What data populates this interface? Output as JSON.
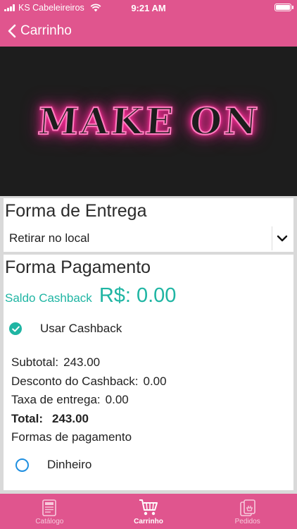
{
  "status_bar": {
    "carrier": "KS Cabeleireiros",
    "time": "9:21 AM"
  },
  "nav": {
    "back_label": "Carrinho"
  },
  "banner": {
    "logo_text": "MAKE ON"
  },
  "delivery": {
    "title": "Forma de Entrega",
    "selected_option": "Retirar no local"
  },
  "payment": {
    "title": "Forma Pagamento",
    "cashback_label": "Saldo Cashback",
    "cashback_value": "R$: 0.00",
    "use_cashback_label": "Usar Cashback",
    "use_cashback_checked": true,
    "subtotal_label": "Subtotal:",
    "subtotal_value": "243.00",
    "discount_label": "Desconto do Cashback:",
    "discount_value": "0.00",
    "delivery_fee_label": "Taxa de entrega:",
    "delivery_fee_value": "0.00",
    "total_label": "Total:",
    "total_value": "243.00",
    "methods_label": "Formas de pagamento",
    "methods": [
      {
        "label": "Dinheiro",
        "selected": false
      }
    ]
  },
  "tabs": [
    {
      "label": "Catálogo",
      "icon": "menu-card-icon",
      "active": false
    },
    {
      "label": "Carrinho",
      "icon": "cart-icon",
      "active": true
    },
    {
      "label": "Pedidos",
      "icon": "orders-icon",
      "active": false
    }
  ],
  "colors": {
    "brand_pink": "#e0558e",
    "accent_teal": "#1fb5a3",
    "radio_blue": "#1f8fe0"
  }
}
